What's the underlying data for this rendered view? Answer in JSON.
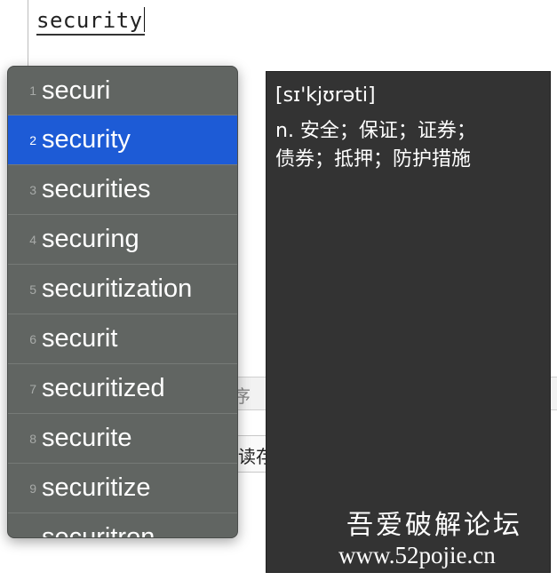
{
  "editor": {
    "typed_word": "security"
  },
  "background": {
    "table_text": "序",
    "button_text": "读存"
  },
  "suggestions": {
    "selected_index": 1,
    "items": [
      {
        "num": "1",
        "word": "securi"
      },
      {
        "num": "2",
        "word": "security"
      },
      {
        "num": "3",
        "word": "securities"
      },
      {
        "num": "4",
        "word": "securing"
      },
      {
        "num": "5",
        "word": "securitization"
      },
      {
        "num": "6",
        "word": "securit"
      },
      {
        "num": "7",
        "word": "securitized"
      },
      {
        "num": "8",
        "word": "securite"
      },
      {
        "num": "9",
        "word": "securitize"
      },
      {
        "num": "",
        "word": "securitron"
      }
    ]
  },
  "definition": {
    "phonetic": "[sɪ'kjʊrəti]",
    "line1": "n. 安全；保证；证券；",
    "line2": "债券；抵押；防护措施"
  },
  "watermark": {
    "site_name": "吾爱破解论坛",
    "url": "www.52pojie.cn"
  },
  "colors": {
    "popup_bg": "#616562",
    "selected_bg": "#1d5bd6",
    "definition_bg": "#333333"
  }
}
